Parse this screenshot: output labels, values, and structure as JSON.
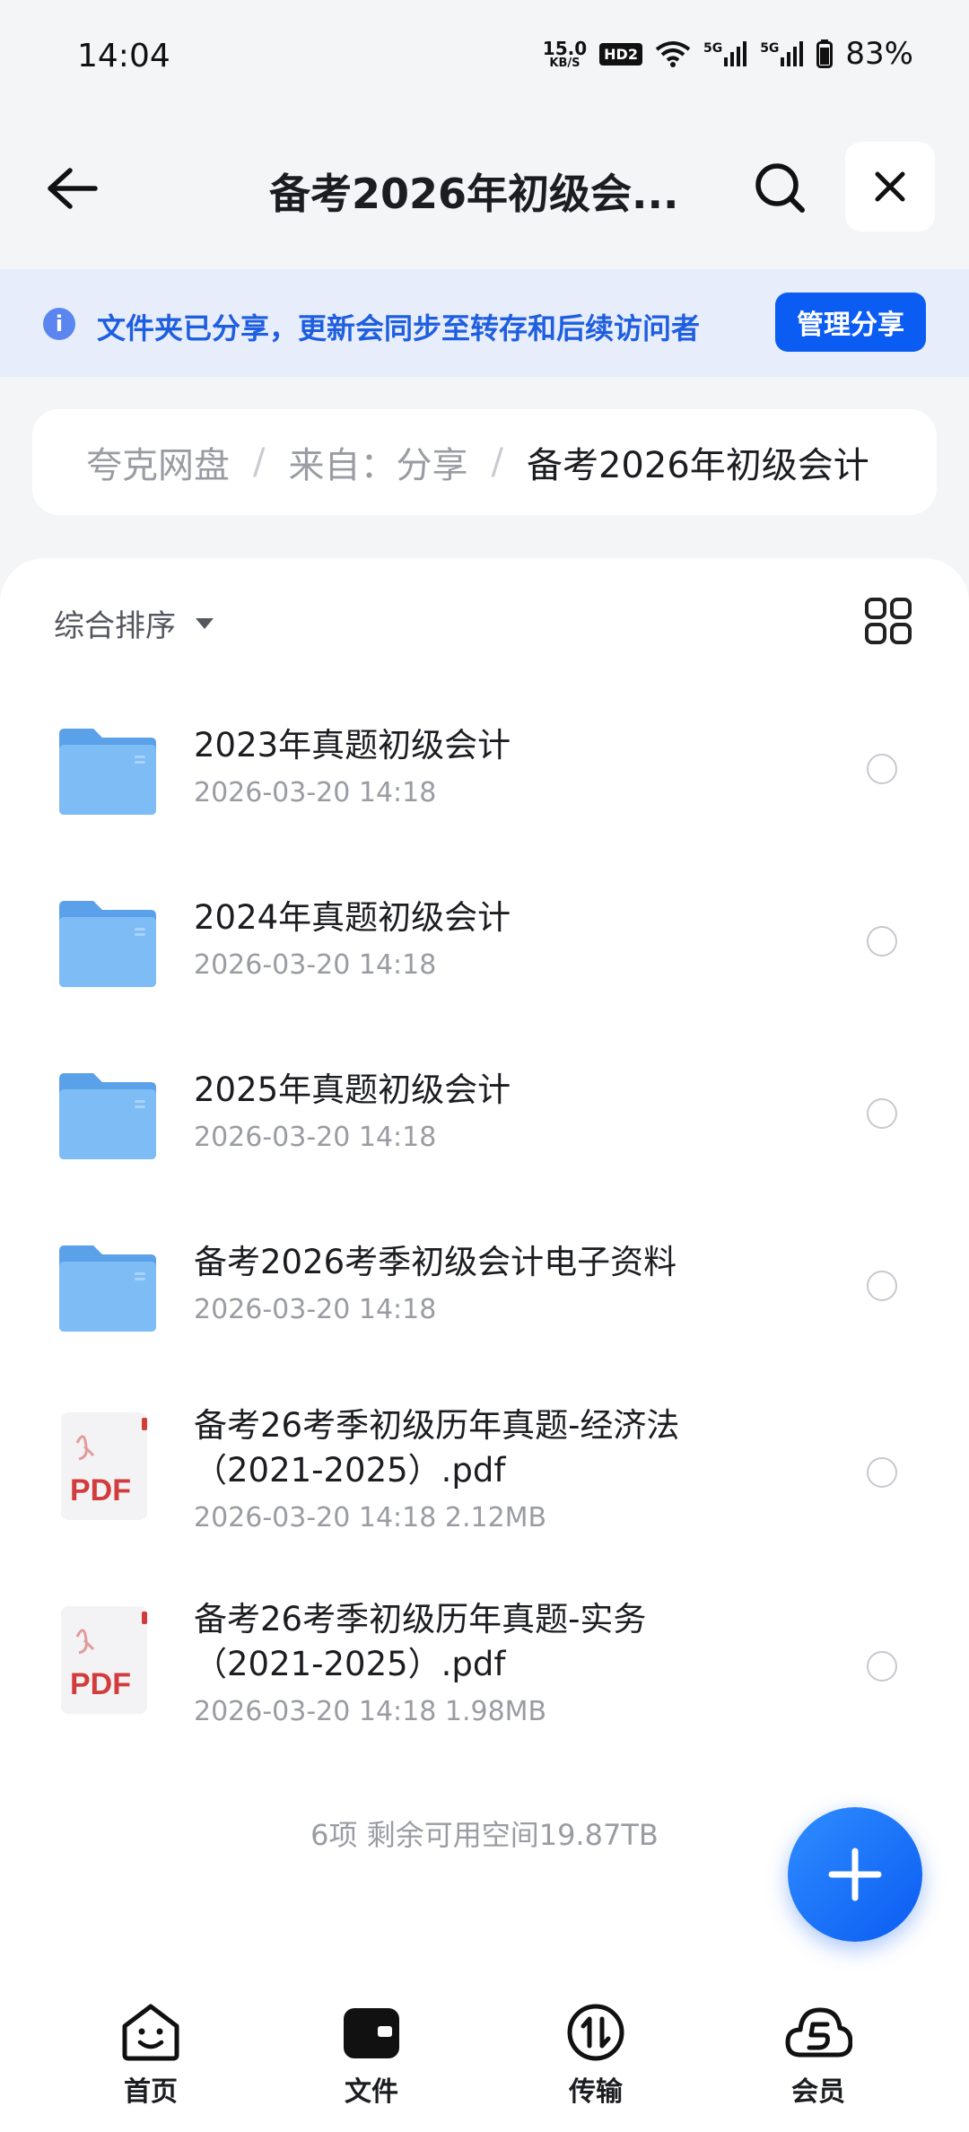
{
  "status_bar": {
    "time": "14:04",
    "net_speed_value": "15.0",
    "net_speed_unit": "KB/S",
    "hd_badge": "HD2",
    "signal_1": "5G",
    "signal_2": "5G",
    "battery": "83%"
  },
  "header": {
    "title": "备考2026年初级会..."
  },
  "share_banner": {
    "text": "文件夹已分享，更新会同步至转存和后续访问者",
    "button_label": "管理分享"
  },
  "breadcrumb": {
    "items": [
      "夸克网盘",
      "来自：分享",
      "备考2026年初级会计"
    ]
  },
  "sort": {
    "label": "综合排序"
  },
  "files": [
    {
      "type": "folder",
      "name": "2023年真题初级会计",
      "meta": "2026-03-20 14:18"
    },
    {
      "type": "folder",
      "name": "2024年真题初级会计",
      "meta": "2026-03-20 14:18"
    },
    {
      "type": "folder",
      "name": "2025年真题初级会计",
      "meta": "2026-03-20 14:18"
    },
    {
      "type": "folder",
      "name": "备考2026考季初级会计电子资料",
      "meta": "2026-03-20 14:18"
    },
    {
      "type": "pdf",
      "name": "备考26考季初级历年真题-经济法（2021-2025）.pdf",
      "meta": "2026-03-20 14:18  2.12MB",
      "icon_label": "PDF"
    },
    {
      "type": "pdf",
      "name": "备考26考季初级历年真题-实务（2021-2025）.pdf",
      "meta": "2026-03-20 14:18  1.98MB",
      "icon_label": "PDF"
    }
  ],
  "footer": {
    "summary": "6项 剩余可用空间19.87TB"
  },
  "bottom_nav": {
    "items": [
      {
        "label": "首页",
        "icon": "home-smile-icon"
      },
      {
        "label": "文件",
        "icon": "wallet-file-icon"
      },
      {
        "label": "传输",
        "icon": "transfer-icon"
      },
      {
        "label": "会员",
        "icon": "cloud-vip-icon"
      }
    ]
  },
  "colors": {
    "accent": "#0b5cf2",
    "banner_bg": "#e8edfb",
    "folder": "#6aaef0",
    "pdf_red": "#d23c3c"
  }
}
